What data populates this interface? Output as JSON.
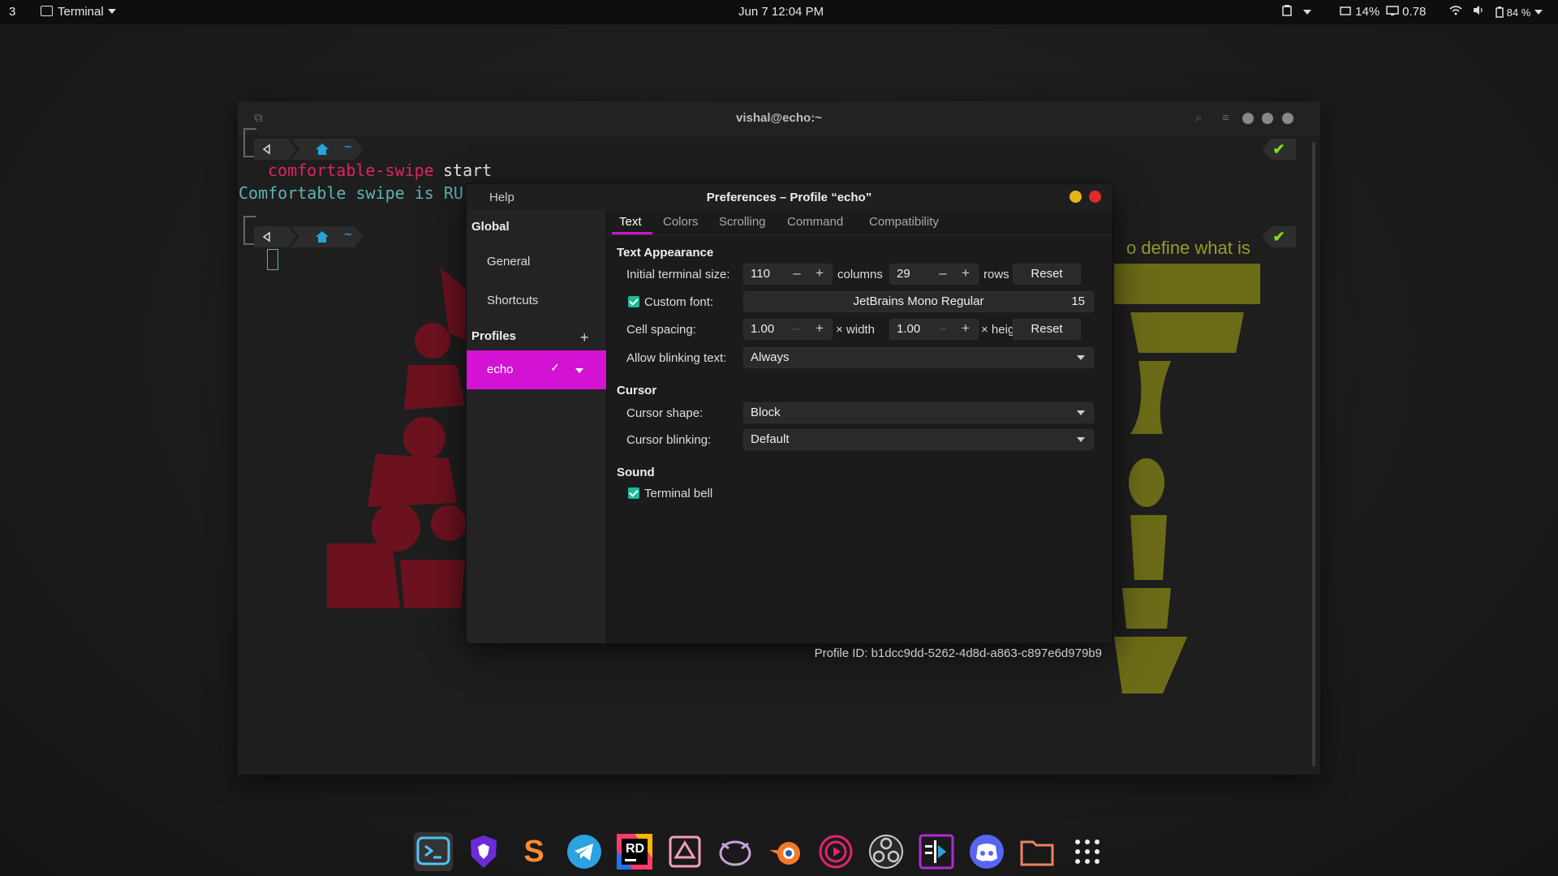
{
  "topbar": {
    "workspace": "3",
    "app_menu": "Terminal",
    "datetime": "Jun 7  12:04 PM",
    "cpu": "14%",
    "load": "0.78",
    "battery": "84 %"
  },
  "terminal": {
    "title": "vishal@echo:~",
    "home_symbol": "~",
    "command_name": "comfortable-swipe",
    "command_arg": "start",
    "output_line": "Comfortable swipe is RU",
    "ok_mark": "✔"
  },
  "wallpaper_text": "o define what is",
  "prefs": {
    "help": "Help",
    "title": "Preferences – Profile “echo”",
    "sidebar": {
      "global": "Global",
      "general": "General",
      "shortcuts": "Shortcuts",
      "profiles": "Profiles",
      "add": "+",
      "profile_name": "echo",
      "profile_check": "✓"
    },
    "tabs": [
      "Text",
      "Colors",
      "Scrolling",
      "Command",
      "Compatibility"
    ],
    "text_appearance": {
      "heading": "Text Appearance",
      "initial_size_label": "Initial terminal size:",
      "columns_value": "110",
      "columns_unit": "columns",
      "rows_value": "29",
      "rows_unit": "rows",
      "reset1": "Reset",
      "custom_font_label": "Custom font:",
      "font_name": "JetBrains Mono Regular",
      "font_size": "15",
      "cell_spacing_label": "Cell spacing:",
      "width_value": "1.00",
      "width_unit": "× width",
      "height_value": "1.00",
      "height_unit": "× height",
      "reset2": "Reset",
      "blink_label": "Allow blinking text:",
      "blink_value": "Always"
    },
    "cursor": {
      "heading": "Cursor",
      "shape_label": "Cursor shape:",
      "shape_value": "Block",
      "blinking_label": "Cursor blinking:",
      "blinking_value": "Default"
    },
    "sound": {
      "heading": "Sound",
      "bell_label": "Terminal bell"
    },
    "profile_id": "Profile ID:  b1dcc9dd-5262-4d8d-a863-c897e6d979b9",
    "stepper_minus": "–",
    "stepper_plus": "+"
  },
  "dock": {
    "sublime_letter": "S",
    "rider_letters": "RD"
  }
}
